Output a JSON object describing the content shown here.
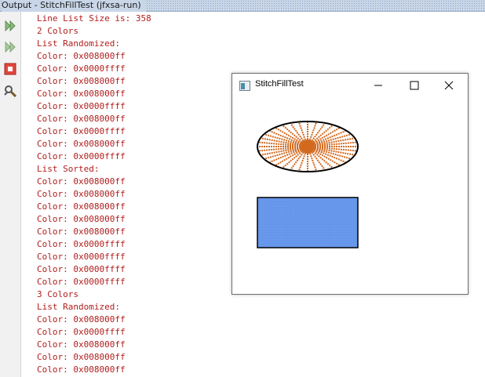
{
  "panel": {
    "title": "Output - StitchFillTest (jfxsa-run)"
  },
  "toolbar": {
    "buttons": [
      {
        "icon": "rerun-icon"
      },
      {
        "icon": "rerun-with-options-icon"
      },
      {
        "icon": "stop-icon"
      },
      {
        "icon": "settings-icon"
      }
    ]
  },
  "console": {
    "lines": [
      "Line List Size is: 358",
      "2 Colors",
      "List Randomized:",
      "Color: 0x008000ff",
      "Color: 0x0000ffff",
      "Color: 0x008000ff",
      "Color: 0x008000ff",
      "Color: 0x0000ffff",
      "Color: 0x008000ff",
      "Color: 0x0000ffff",
      "Color: 0x008000ff",
      "Color: 0x0000ffff",
      "List Sorted:",
      "Color: 0x008000ff",
      "Color: 0x008000ff",
      "Color: 0x008000ff",
      "Color: 0x008000ff",
      "Color: 0x008000ff",
      "Color: 0x0000ffff",
      "Color: 0x0000ffff",
      "Color: 0x0000ffff",
      "Color: 0x0000ffff",
      "3 Colors",
      "List Randomized:",
      "Color: 0x008000ff",
      "Color: 0x0000ffff",
      "Color: 0x008000ff",
      "Color: 0x008000ff",
      "Color: 0x008000ff"
    ],
    "text_color": "#b21d1d"
  },
  "window": {
    "title": "StitchFillTest",
    "minimize_icon": "minimize-icon",
    "maximize_icon": "maximize-icon",
    "close_icon": "close-icon",
    "colors": {
      "ellipse_stroke": "#000000",
      "spoke": "#d2691e",
      "rect_fill": "#6495ed",
      "rect_stroke": "#000000"
    }
  }
}
